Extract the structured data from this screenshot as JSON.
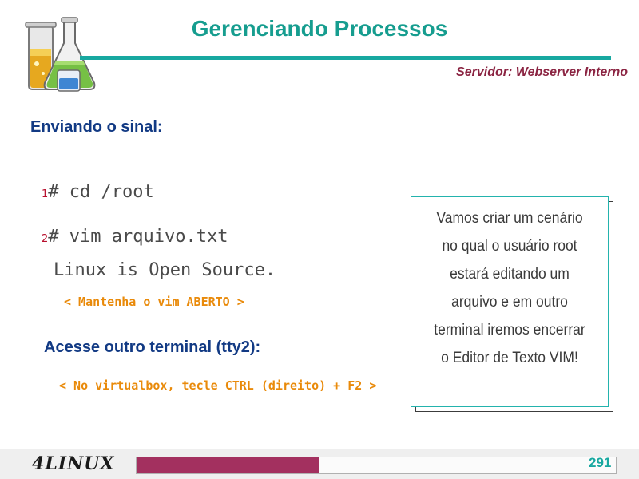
{
  "header": {
    "title": "Gerenciando Processos",
    "subtitle": "Servidor: Webserver Interno"
  },
  "content": {
    "section_heading": "Enviando o sinal:",
    "commands": [
      {
        "num": "1",
        "text": "# cd /root"
      },
      {
        "num": "2",
        "text": "# vim arquivo.txt"
      }
    ],
    "file_line": "Linux is Open Source.",
    "hint_keep_open": "< Mantenha o vim ABERTO >",
    "access_heading": "Acesse outro terminal (tty2):",
    "hint_keys": "< No virtualbox, tecle CTRL (direito) + F2 >"
  },
  "note": {
    "lines": [
      "Vamos criar um cenário",
      "no qual o usuário root",
      "estará editando um",
      "arquivo e em outro",
      "terminal iremos encerrar",
      "o Editor de Texto VIM!"
    ]
  },
  "footer": {
    "logo_text": "LINUX",
    "logo_number": "4",
    "page_number": "291",
    "progress_fraction": 0.38,
    "progress_color": "#a3305f"
  },
  "colors": {
    "title": "#169d8f",
    "subtitle": "#8b2442",
    "heading": "#123a84",
    "hint": "#e98a0a",
    "line_number": "#b80f2d"
  },
  "icons": {
    "header_logo": "lab-flasks-icon"
  }
}
